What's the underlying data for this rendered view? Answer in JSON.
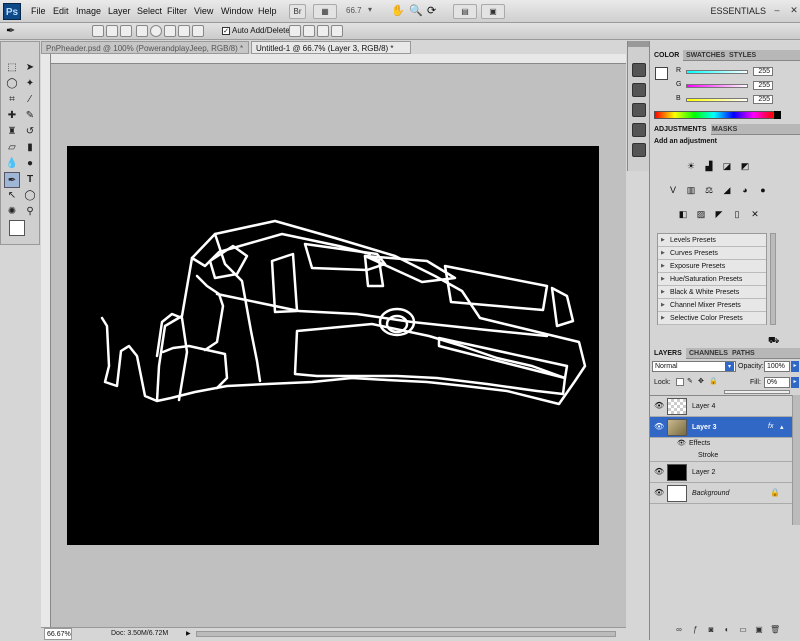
{
  "app": {
    "logo": "Ps",
    "workspace": "ESSENTIALS"
  },
  "menu": [
    "File",
    "Edit",
    "Image",
    "Layer",
    "Select",
    "Filter",
    "View",
    "Window",
    "Help"
  ],
  "appbar": {
    "bridge_label": "Br",
    "zoom": "66.7",
    "zoom_arrow": "▾"
  },
  "options": {
    "auto_add_delete": "Auto Add/Delete",
    "checkbox": "✓"
  },
  "tabs": [
    {
      "label": "PnPheader.psd @ 100% (PowerandplayJeep, RGB/8) *"
    },
    {
      "label": "Untitled-1 @ 66.7% (Layer 3, RGB/8) *"
    }
  ],
  "status": {
    "zoom": "66.67%",
    "doc": "Doc: 3.50M/6.72M"
  },
  "color_panel": {
    "tabs": [
      "COLOR",
      "SWATCHES",
      "STYLES"
    ],
    "r_label": "R",
    "g_label": "G",
    "b_label": "B",
    "r": "255",
    "g": "255",
    "b": "255"
  },
  "adjustments": {
    "tabs": [
      "ADJUSTMENTS",
      "MASKS"
    ],
    "heading": "Add an adjustment",
    "presets": [
      "Levels Presets",
      "Curves Presets",
      "Exposure Presets",
      "Hue/Saturation Presets",
      "Black & White Presets",
      "Channel Mixer Presets",
      "Selective Color Presets"
    ]
  },
  "layers": {
    "tabs": [
      "LAYERS",
      "CHANNELS",
      "PATHS"
    ],
    "blend_mode": "Normal",
    "opacity_label": "Opacity:",
    "opacity": "100%",
    "lock_label": "Lock:",
    "fill_label": "Fill:",
    "fill": "0%",
    "items": [
      {
        "name": "Layer 4"
      },
      {
        "name": "Layer 3",
        "fx": "fx"
      },
      {
        "name": "Effects"
      },
      {
        "name": "Stroke"
      },
      {
        "name": "Layer 2"
      },
      {
        "name": "Background"
      }
    ]
  },
  "colors": {
    "accent": "#3168c6",
    "canvas_bg": "#000000",
    "stroke": "#ffffff"
  }
}
